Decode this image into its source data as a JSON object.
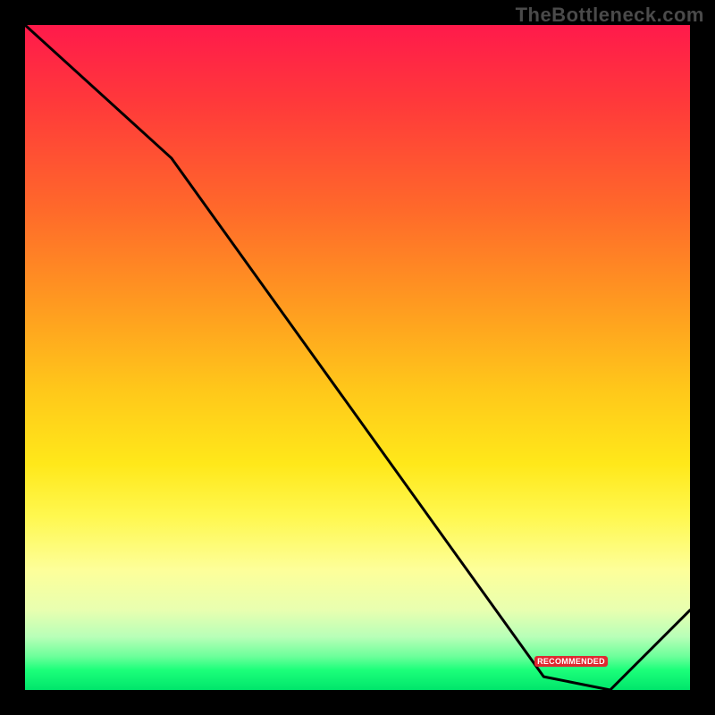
{
  "watermark": "TheBottleneck.com",
  "badge_label": "RECOMMENDED",
  "chart_data": {
    "type": "line",
    "title": "",
    "xlabel": "",
    "ylabel": "",
    "xlim": [
      0,
      100
    ],
    "ylim": [
      0,
      100
    ],
    "series": [
      {
        "name": "bottleneck-curve",
        "x": [
          0,
          22,
          78,
          88,
          100
        ],
        "y": [
          100,
          80,
          2,
          0,
          12
        ]
      }
    ],
    "annotations": [
      {
        "name": "recommended-badge",
        "x": 82,
        "y": 4,
        "text": "RECOMMENDED"
      }
    ],
    "gradient_direction": "vertical",
    "gradient_stops": [
      {
        "pos": 0.0,
        "color": "#ff1a4b"
      },
      {
        "pos": 0.5,
        "color": "#ffc81a"
      },
      {
        "pos": 0.8,
        "color": "#fdff9a"
      },
      {
        "pos": 1.0,
        "color": "#00e56b"
      }
    ]
  }
}
